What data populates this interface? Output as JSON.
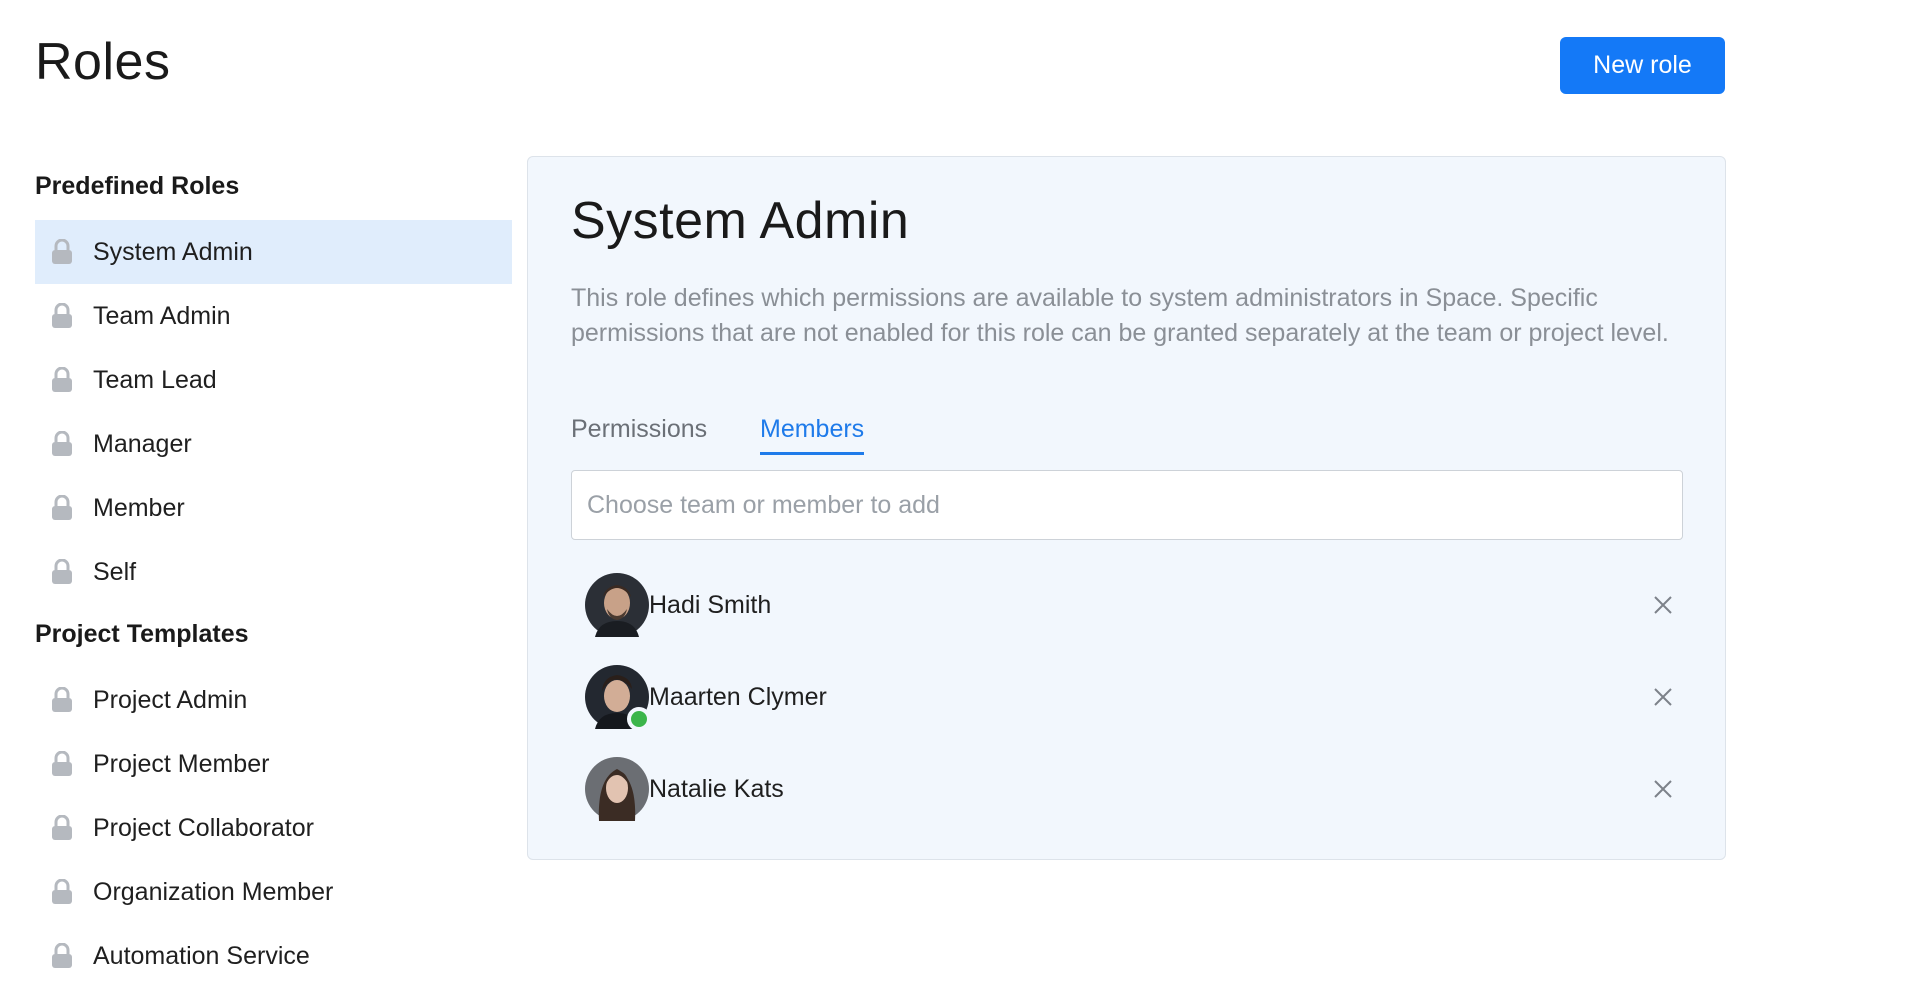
{
  "header": {
    "title": "Roles",
    "new_role_label": "New role",
    "accent_color": "#1479f7"
  },
  "sidebar": {
    "predefined_title": "Predefined Roles",
    "predefined_roles": [
      {
        "label": "System Admin",
        "selected": true,
        "icon": "lock-icon"
      },
      {
        "label": "Team Admin",
        "icon": "lock-icon"
      },
      {
        "label": "Team Lead",
        "icon": "lock-icon"
      },
      {
        "label": "Manager",
        "icon": "lock-icon"
      },
      {
        "label": "Member",
        "icon": "lock-icon"
      },
      {
        "label": "Self",
        "icon": "lock-icon"
      }
    ],
    "templates_title": "Project Templates",
    "project_templates": [
      {
        "label": "Project Admin",
        "icon": "lock-icon"
      },
      {
        "label": "Project Member",
        "icon": "lock-icon"
      },
      {
        "label": "Project Collaborator",
        "icon": "lock-icon"
      },
      {
        "label": "Organization Member",
        "icon": "lock-icon"
      },
      {
        "label": "Automation Service",
        "icon": "lock-icon"
      }
    ]
  },
  "detail": {
    "title": "System Admin",
    "description": "This role defines which permissions are available to system administrators in Space. Specific permissions that are not enabled for this role can be granted separately at the team or project level.",
    "tabs": [
      {
        "label": "Permissions",
        "active": false
      },
      {
        "label": "Members",
        "active": true
      }
    ],
    "search": {
      "placeholder": "Choose team or member to add",
      "value": ""
    },
    "members": [
      {
        "name": "Hadi Smith",
        "online": false,
        "icon": "close-icon"
      },
      {
        "name": "Maarten Clymer",
        "online": true,
        "icon": "close-icon"
      },
      {
        "name": "Natalie Kats",
        "online": false,
        "icon": "close-icon"
      }
    ]
  }
}
